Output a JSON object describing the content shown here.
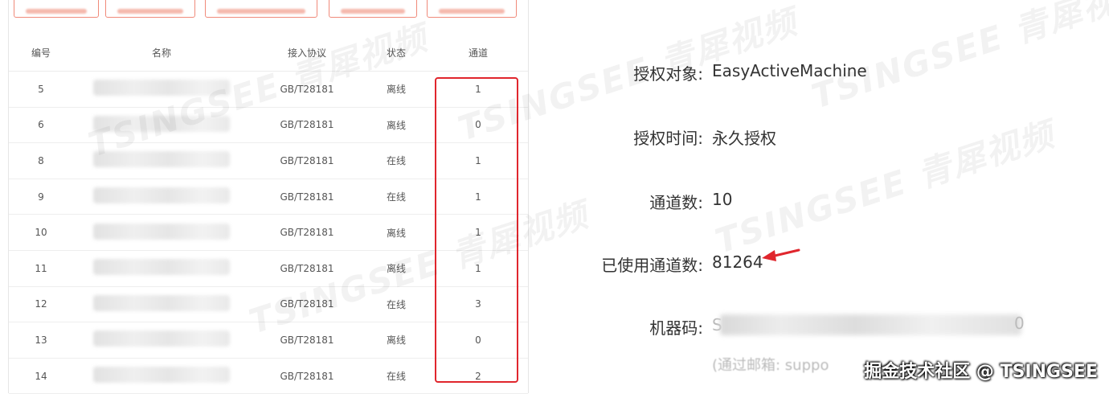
{
  "table": {
    "headers": [
      "编号",
      "名称",
      "接入协议",
      "状态",
      "通道"
    ],
    "rows": [
      {
        "id": "5",
        "protocol": "GB/T28181",
        "status": "离线",
        "status_type": "offline",
        "channels": "1"
      },
      {
        "id": "6",
        "protocol": "GB/T28181",
        "status": "离线",
        "status_type": "offline",
        "channels": "0"
      },
      {
        "id": "8",
        "protocol": "GB/T28181",
        "status": "在线",
        "status_type": "online",
        "channels": "1"
      },
      {
        "id": "9",
        "protocol": "GB/T28181",
        "status": "在线",
        "status_type": "online",
        "channels": "1"
      },
      {
        "id": "10",
        "protocol": "GB/T28181",
        "status": "离线",
        "status_type": "offline",
        "channels": "1"
      },
      {
        "id": "11",
        "protocol": "GB/T28181",
        "status": "离线",
        "status_type": "offline",
        "channels": "1"
      },
      {
        "id": "12",
        "protocol": "GB/T28181",
        "status": "在线",
        "status_type": "online",
        "channels": "3"
      },
      {
        "id": "13",
        "protocol": "GB/T28181",
        "status": "离线",
        "status_type": "offline",
        "channels": "0"
      },
      {
        "id": "14",
        "protocol": "GB/T28181",
        "status": "在线",
        "status_type": "online",
        "channels": "2"
      }
    ]
  },
  "license": {
    "object_label": "授权对象:",
    "object_value": "EasyActiveMachine",
    "time_label": "授权时间:",
    "time_value": "永久授权",
    "channels_label": "通道数:",
    "channels_value": "10",
    "used_label": "已使用通道数:",
    "used_value": "81264",
    "machine_label": "机器码:",
    "machine_prefix": "S",
    "machine_suffix": "0",
    "note_prefix": "(通过邮箱: suppo"
  },
  "watermark": {
    "text": "TSINGSEE 青犀视频"
  },
  "credit": "掘金技术社区 @ TSINGSEE",
  "colors": {
    "online": "#3cb371",
    "offline": "#c9c9c9",
    "highlight": "#e0262d"
  }
}
